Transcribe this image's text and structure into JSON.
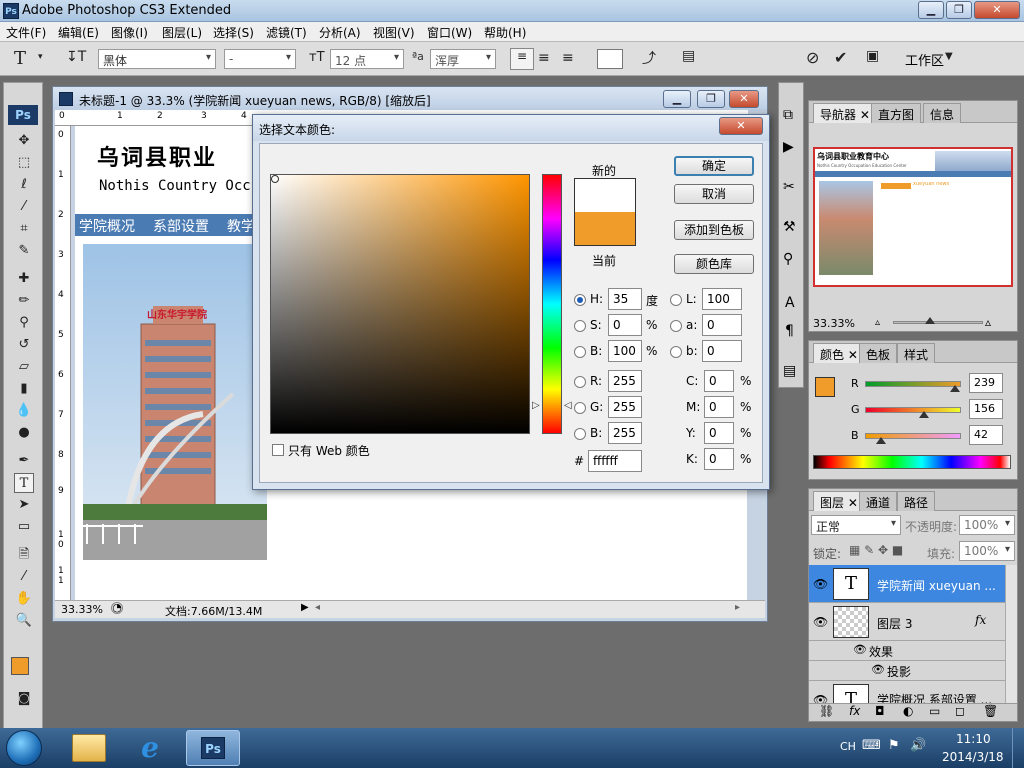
{
  "app": {
    "title": "Adobe Photoshop CS3 Extended",
    "ps_icon": "Ps"
  },
  "menu": [
    "文件(F)",
    "编辑(E)",
    "图像(I)",
    "图层(L)",
    "选择(S)",
    "滤镜(T)",
    "分析(A)",
    "视图(V)",
    "窗口(W)",
    "帮助(H)"
  ],
  "options": {
    "font_family": "黑体",
    "font_style": "-",
    "font_size": "12 点",
    "aa_label": "a",
    "antialias": "浑厚",
    "workspace": "工作区"
  },
  "document": {
    "title": "未标题-1 @ 33.3% (学院新闻  xueyuan news, RGB/8) [缩放后]",
    "heading": "乌词县职业",
    "subheading": "Nothis Country Occ",
    "nav": [
      "学院概况",
      "系部设置",
      "教学"
    ],
    "ruler_h": [
      "0",
      "1",
      "2",
      "3",
      "4"
    ],
    "ruler_v": [
      "0",
      "1",
      "2",
      "3",
      "4",
      "5",
      "6",
      "7",
      "8",
      "9",
      "1\n0",
      "1\n1"
    ],
    "zoom": "33.33%",
    "doc_info": "文档:7.66M/13.4M",
    "building_sign": "山东华宇学院"
  },
  "dialog": {
    "title": "选择文本颜色:",
    "new_label": "新的",
    "current_label": "当前",
    "ok": "确定",
    "cancel": "取消",
    "add_swatch": "添加到色板",
    "color_lib": "颜色库",
    "web_only": "只有 Web 颜色",
    "fields": {
      "H": {
        "label": "H:",
        "value": "35",
        "unit": "度"
      },
      "S": {
        "label": "S:",
        "value": "0",
        "unit": "%"
      },
      "Bv": {
        "label": "B:",
        "value": "100",
        "unit": "%"
      },
      "R": {
        "label": "R:",
        "value": "255"
      },
      "G": {
        "label": "G:",
        "value": "255"
      },
      "Bb": {
        "label": "B:",
        "value": "255"
      },
      "L": {
        "label": "L:",
        "value": "100"
      },
      "a": {
        "label": "a:",
        "value": "0"
      },
      "b": {
        "label": "b:",
        "value": "0"
      },
      "C": {
        "label": "C:",
        "value": "0",
        "unit": "%"
      },
      "M": {
        "label": "M:",
        "value": "0",
        "unit": "%"
      },
      "Y": {
        "label": "Y:",
        "value": "0",
        "unit": "%"
      },
      "K": {
        "label": "K:",
        "value": "0",
        "unit": "%"
      },
      "hex": {
        "label": "#",
        "value": "ffffff"
      }
    },
    "new_color": "#ffffff",
    "current_color": "#ef9c2a"
  },
  "navigator": {
    "tabs": [
      "导航器",
      "直方图",
      "信息"
    ],
    "zoom": "33.33%",
    "thumb_heading": "乌词县职业教育中心",
    "thumb_sub": "Nothis Country Occupation Education Center",
    "thumb_nav_text": "xueyuan news"
  },
  "color_panel": {
    "tabs": [
      "颜色",
      "色板",
      "样式"
    ],
    "channels": [
      {
        "label": "R",
        "value": "239",
        "fraction": 0.937
      },
      {
        "label": "G",
        "value": "156",
        "fraction": 0.612
      },
      {
        "label": "B",
        "value": "42",
        "fraction": 0.165
      }
    ],
    "fg_color": "#ef9c2a"
  },
  "layers": {
    "tabs": [
      "图层",
      "通道",
      "路径"
    ],
    "blend_mode": "正常",
    "opacity_label": "不透明度:",
    "opacity": "100%",
    "lock_label": "锁定:",
    "fill_label": "填充:",
    "fill": "100%",
    "items": [
      {
        "name": "学院新闻  xueyuan ...",
        "type": "text",
        "selected": true
      },
      {
        "name": "图层 3",
        "type": "image",
        "fx": "fx"
      },
      {
        "name": "效果",
        "type": "effect"
      },
      {
        "name": "投影",
        "type": "effect-item"
      },
      {
        "name": "学院概况 系部设置 ...",
        "type": "text"
      }
    ]
  },
  "taskbar": {
    "lang": "CH",
    "time": "11:10",
    "date": "2014/3/18",
    "ps_label": "Ps"
  },
  "colors": {
    "accent_orange": "#ef9c2a",
    "selected_layer": "#3d87e0"
  }
}
